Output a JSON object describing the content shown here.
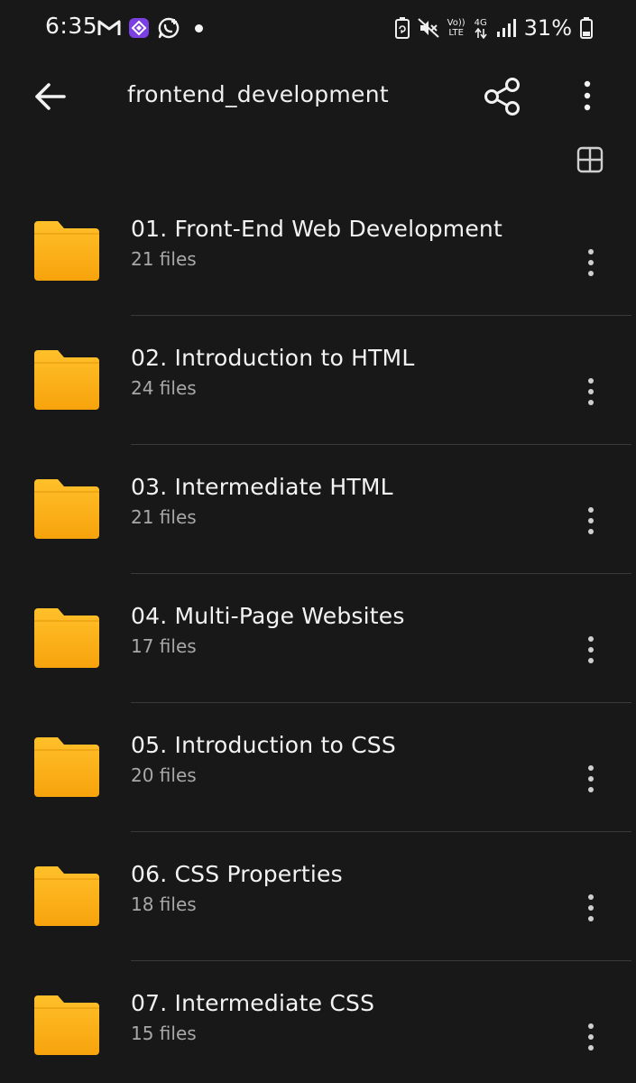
{
  "status_bar": {
    "time": "6:35",
    "lte_top": "Vo))",
    "lte_bottom": "LTE",
    "net_type": "4G",
    "battery_percent": "31%",
    "icons": [
      "gmail-icon",
      "app-icon",
      "whatsapp-icon",
      "notification-dot",
      "battery-saver-icon",
      "mute-icon",
      "volte-icon",
      "4g-icon",
      "signal-icon",
      "battery-icon"
    ]
  },
  "app_bar": {
    "title": "frontend_development",
    "back_icon": "arrow-left-icon",
    "share_icon": "share-icon",
    "more_icon": "more-vertical-icon"
  },
  "view_toggle_icon": "grid-view-icon",
  "folders": [
    {
      "name": "01. Front-End Web Development",
      "count": "21 files"
    },
    {
      "name": "02. Introduction to HTML",
      "count": "24 files"
    },
    {
      "name": "03. Intermediate HTML",
      "count": "21 files"
    },
    {
      "name": "04. Multi-Page Websites",
      "count": "17 files"
    },
    {
      "name": "05. Introduction to CSS",
      "count": "20 files"
    },
    {
      "name": "06. CSS Properties",
      "count": "18 files"
    },
    {
      "name": "07. Intermediate CSS",
      "count": "15 files"
    }
  ],
  "colors": {
    "background": "#181818",
    "folder": "#f9a80f",
    "divider": "#3a3a3a",
    "secondary_text": "#a8a8a8",
    "accent_app_icon": "#7b3fe4"
  }
}
